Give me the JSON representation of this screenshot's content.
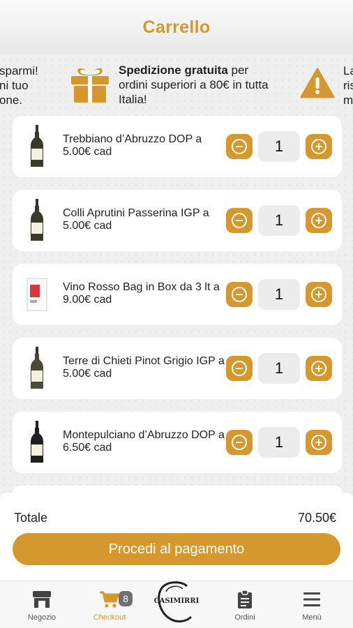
{
  "header": {
    "title": "Carrello"
  },
  "promo": {
    "left_lines": [
      "sparmi!",
      "ni tuo",
      "one."
    ],
    "center_bold": "Spedizione gratuita",
    "center_rest": " per ordini superiori a 80€ in tutta Italia!",
    "right_lines": [
      "La",
      "ris",
      "m"
    ],
    "accent_color": "#d4982c"
  },
  "cart": {
    "items": [
      {
        "name": "Trebbiano d’Abruzzo DOP a 5.00€ cad",
        "qty": "1",
        "thumb": "white-wine-bottle"
      },
      {
        "name": "Colli Aprutini Passerina IGP a 5.00€ cad",
        "qty": "1",
        "thumb": "white-wine-bottle"
      },
      {
        "name": "Vino Rosso Bag in Box da 3 lt a 9.00€ cad",
        "qty": "1",
        "thumb": "bag-in-box"
      },
      {
        "name": "Terre di Chieti Pinot Grigio IGP a 5.00€ cad",
        "qty": "1",
        "thumb": "white-wine-bottle"
      },
      {
        "name": "Montepulciano d’Abruzzo DOP a 6.50€ cad",
        "qty": "1",
        "thumb": "red-wine-bottle"
      }
    ]
  },
  "footer": {
    "total_label": "Totale",
    "total_value": "70.50€",
    "pay_label": "Procedi al pagamento"
  },
  "nav": {
    "items": [
      {
        "label": "Negozio",
        "icon": "store-icon"
      },
      {
        "label": "Checkout",
        "icon": "cart-icon",
        "badge": "8"
      },
      {
        "label": "Ordini",
        "icon": "clipboard-icon"
      },
      {
        "label": "Menù",
        "icon": "hamburger-icon"
      }
    ],
    "logo_text": "CASIMIRRI"
  }
}
